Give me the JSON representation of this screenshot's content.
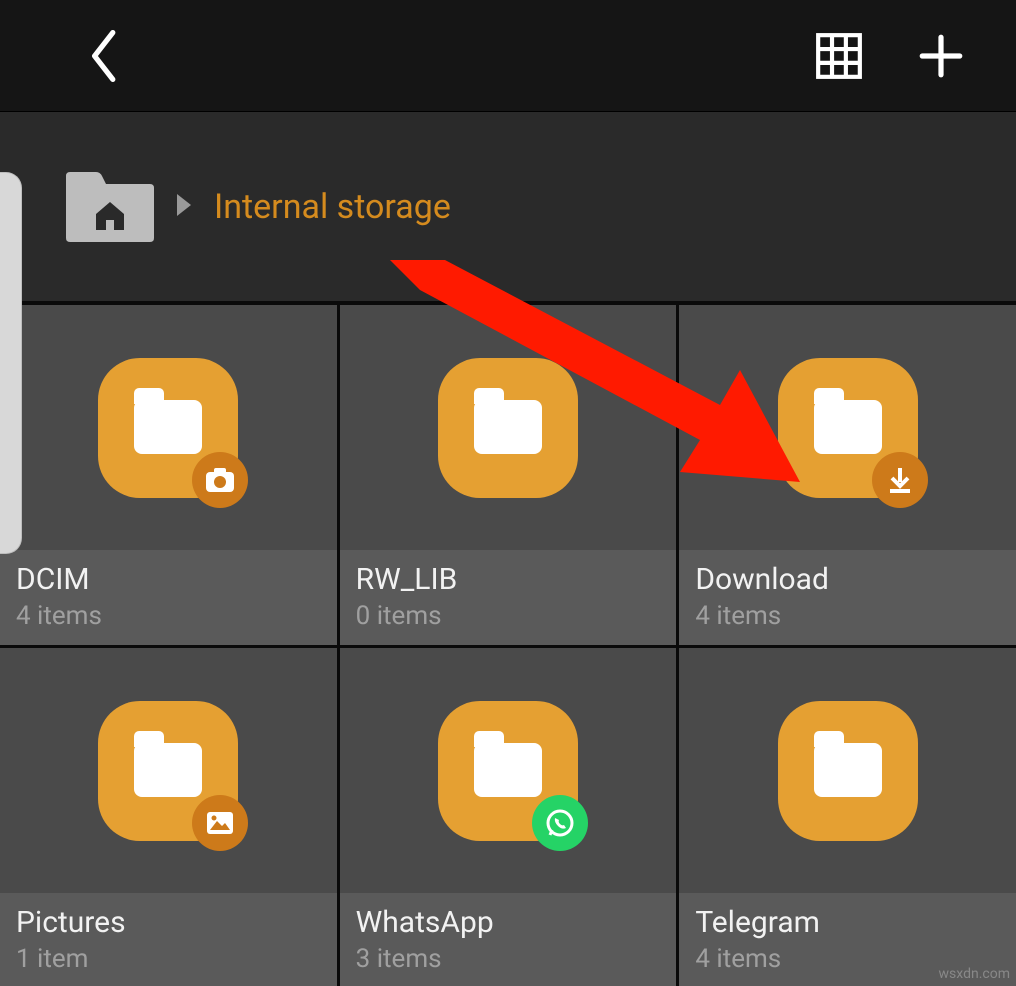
{
  "breadcrumb": {
    "current": "Internal storage"
  },
  "folders": [
    {
      "name": "DCIM",
      "count": "4 items",
      "badge": "camera"
    },
    {
      "name": "RW_LIB",
      "count": "0 items",
      "badge": null
    },
    {
      "name": "Download",
      "count": "4 items",
      "badge": "download"
    },
    {
      "name": "Pictures",
      "count": "1 item",
      "badge": "image"
    },
    {
      "name": "WhatsApp",
      "count": "3 items",
      "badge": "whatsapp"
    },
    {
      "name": "Telegram",
      "count": "4 items",
      "badge": null
    }
  ],
  "colors": {
    "accent": "#d58b1e",
    "folder": "#e5a032",
    "annotation_arrow": "#ff1a00"
  },
  "watermark": "wsxdn.com"
}
